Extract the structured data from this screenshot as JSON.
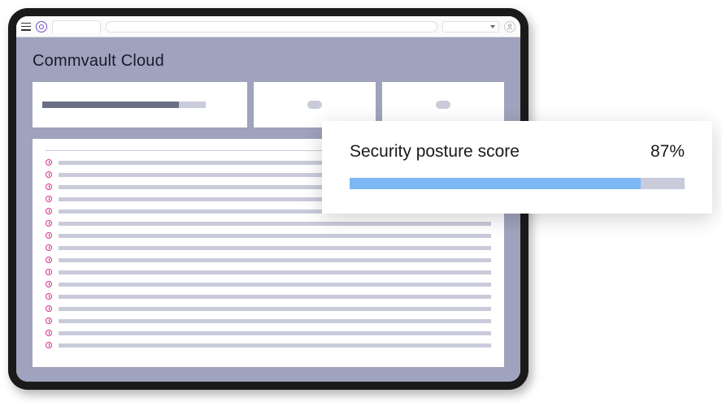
{
  "app": {
    "title": "Commvault Cloud"
  },
  "popup": {
    "title": "Security posture score",
    "value": "87%",
    "progress_percent": 87
  },
  "list": {
    "row_count": 16
  },
  "colors": {
    "accent_blue": "#7cb8f5",
    "bg_lavender": "#9fa3bd",
    "icon_pink": "#d63384"
  }
}
